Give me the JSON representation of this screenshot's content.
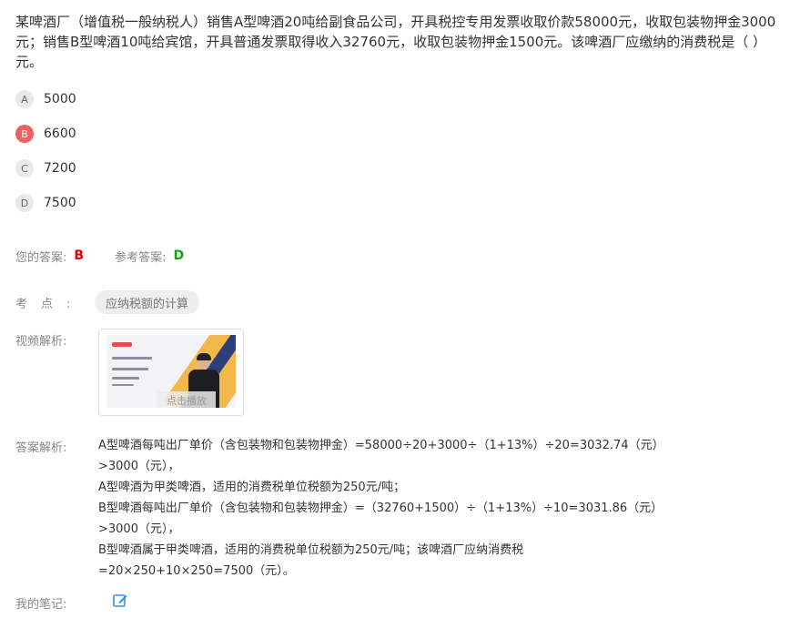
{
  "question": {
    "text": "某啤酒厂（增值税一般纳税人）销售A型啤酒20吨给副食品公司，开具税控专用发票收取价款58000元，收取包装物押金3000元；销售B型啤酒10吨给宾馆，开具普通发票取得收入32760元，收取包装物押金1500元。该啤酒厂应缴纳的消费税是（ ）元。"
  },
  "options": [
    {
      "letter": "A",
      "text": "5000",
      "selected": false
    },
    {
      "letter": "B",
      "text": "6600",
      "selected": true
    },
    {
      "letter": "C",
      "text": "7200",
      "selected": false
    },
    {
      "letter": "D",
      "text": "7500",
      "selected": false
    }
  ],
  "answer": {
    "your_label": "您的答案:",
    "your_value": "B",
    "ref_label": "参考答案:",
    "ref_value": "D",
    "colors": {
      "wrong": "#e00000",
      "correct": "#17a317"
    }
  },
  "knowledge_point": {
    "label": "考点:",
    "tag": "应纳税额的计算"
  },
  "video": {
    "label": "视频解析:",
    "overlay_text": "点击播放",
    "icon": "video-thumbnail"
  },
  "analysis": {
    "label": "答案解析:",
    "lines": [
      "A型啤酒每吨出厂单价（含包装物和包装物押金）=58000÷20+3000÷（1+13%）÷20=3032.74（元）",
      ">3000（元），",
      "A型啤酒为甲类啤酒，适用的消费税单位税额为250元/吨；",
      "B型啤酒每吨出厂单价（含包装物和包装物押金）=（32760+1500）÷（1+13%）÷10=3031.86（元）",
      ">3000（元），",
      "B型啤酒属于甲类啤酒，适用的消费税单位税额为250元/吨；该啤酒厂应纳消费税",
      "=20×250+10×250=7500（元）。"
    ]
  },
  "notes": {
    "label": "我的笔记:",
    "icon": "edit-icon"
  }
}
